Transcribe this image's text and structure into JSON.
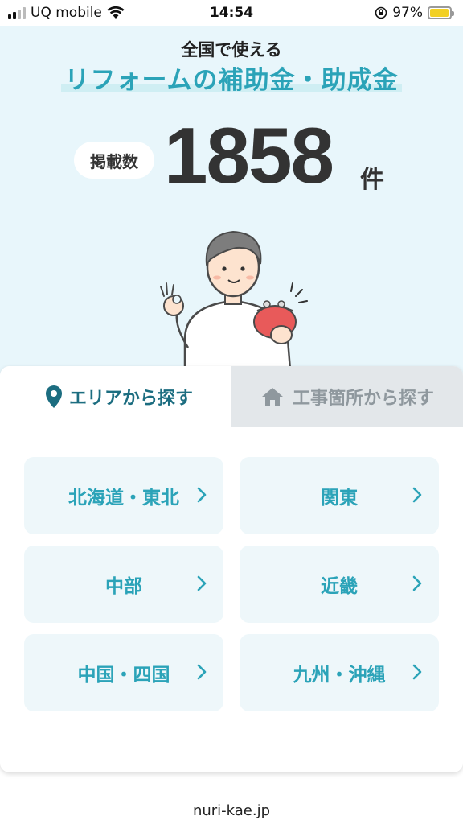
{
  "status_bar": {
    "carrier": "UQ mobile",
    "time": "14:54",
    "battery": "97%",
    "battery_level": 0.97
  },
  "hero": {
    "subtitle": "全国で使える",
    "title": "リフォームの補助金・助成金",
    "count_label": "掲載数",
    "count_value": "1858",
    "count_unit": "件"
  },
  "tabs": [
    {
      "label": "エリアから探す",
      "icon": "location-pin-icon",
      "active": true
    },
    {
      "label": "工事箇所から探す",
      "icon": "house-icon",
      "active": false
    }
  ],
  "regions": [
    {
      "label": "北海道・東北"
    },
    {
      "label": "関東"
    },
    {
      "label": "中部"
    },
    {
      "label": "近畿"
    },
    {
      "label": "中国・四国"
    },
    {
      "label": "九州・沖縄"
    }
  ],
  "colors": {
    "accent": "#2ba3b8",
    "hero_bg": "#e8f6fb",
    "button_bg": "#eef7fa",
    "inactive_tab_bg": "#e3e7ea",
    "purse": "#e85a5a"
  },
  "footer": {
    "url": "nuri-kae.jp"
  }
}
